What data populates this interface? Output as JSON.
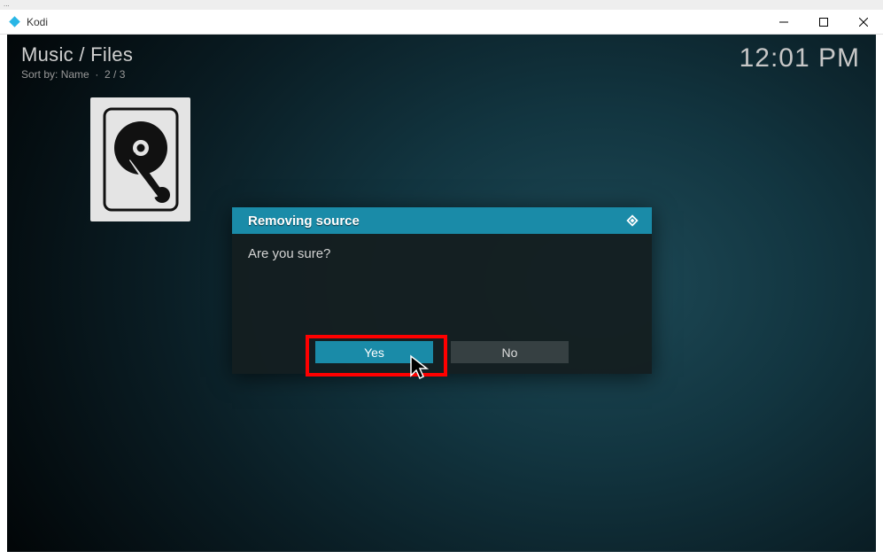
{
  "url_bar": "...",
  "titlebar": {
    "app_name": "Kodi"
  },
  "header": {
    "breadcrumb": "Music / Files",
    "sort_prefix": "Sort by: ",
    "sort_value": "Name",
    "separator": "·",
    "position": "2 / 3"
  },
  "clock": "12:01 PM",
  "dialog": {
    "title": "Removing source",
    "message": "Are you sure?",
    "yes_label": "Yes",
    "no_label": "No"
  }
}
